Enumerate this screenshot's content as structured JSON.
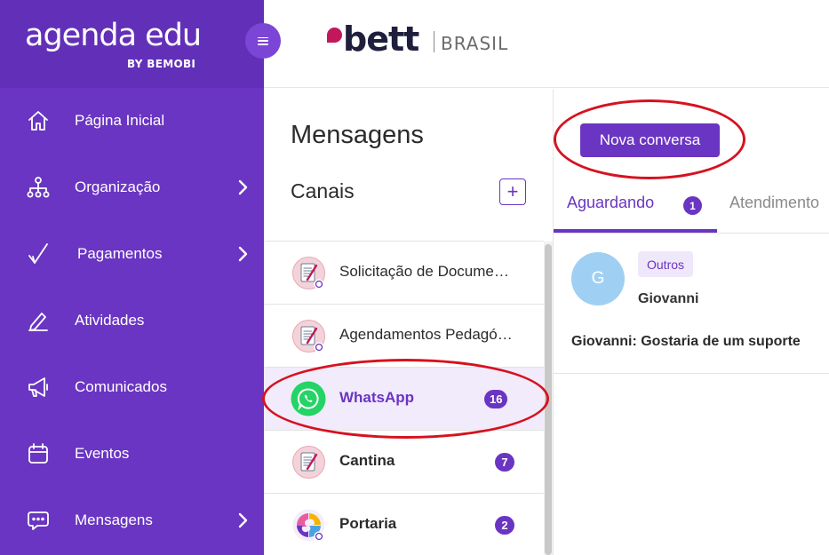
{
  "brand": {
    "logo_main": "agenda edu",
    "logo_sub": "BY BEMOBI",
    "partner_name": "bett",
    "partner_country": "BRASIL"
  },
  "sidebar": {
    "items": [
      {
        "label": "Página Inicial",
        "icon": "home-icon",
        "has_submenu": false
      },
      {
        "label": "Organização",
        "icon": "org-chart-icon",
        "has_submenu": true
      },
      {
        "label": "Pagamentos",
        "icon": "checkmark-icon",
        "has_submenu": true
      },
      {
        "label": "Atividades",
        "icon": "pencil-icon",
        "has_submenu": false
      },
      {
        "label": "Comunicados",
        "icon": "megaphone-icon",
        "has_submenu": false
      },
      {
        "label": "Eventos",
        "icon": "calendar-icon",
        "has_submenu": false
      },
      {
        "label": "Mensagens",
        "icon": "chat-icon",
        "has_submenu": true
      }
    ]
  },
  "messages": {
    "page_title": "Mensagens",
    "channels_title": "Canais",
    "add_channel_symbol": "+",
    "channels": [
      {
        "name": "Solicitação de Documentos",
        "display": "Solicitação de Docume…",
        "badge": "",
        "avatar": "document-avatar",
        "bold": false,
        "active": false
      },
      {
        "name": "Agendamentos Pedagógicos",
        "display": "Agendamentos Pedagó…",
        "badge": "",
        "avatar": "document-avatar",
        "bold": false,
        "active": false
      },
      {
        "name": "WhatsApp",
        "display": "WhatsApp",
        "badge": "16",
        "avatar": "whatsapp-icon",
        "bold": true,
        "active": true
      },
      {
        "name": "Cantina",
        "display": "Cantina",
        "badge": "7",
        "avatar": "document-avatar",
        "bold": true,
        "active": false
      },
      {
        "name": "Portaria",
        "display": "Portaria",
        "badge": "2",
        "avatar": "puzzle-avatar",
        "bold": true,
        "active": false
      }
    ]
  },
  "conversations": {
    "new_button": "Nova conversa",
    "tabs": [
      {
        "label": "Aguardando",
        "count": "1",
        "active": true
      },
      {
        "label": "Atendimento",
        "count": "",
        "active": false
      }
    ],
    "items": [
      {
        "avatar_initial": "G",
        "tag": "Outros",
        "name": "Giovanni",
        "preview": "Giovanni: Gostaria de um suporte"
      }
    ]
  },
  "colors": {
    "primary": "#6a35c2",
    "sidebar": "#6a35c2",
    "annotation": "#d6121f",
    "whatsapp": "#25d366",
    "avatar_blue": "#9fd0f4"
  }
}
